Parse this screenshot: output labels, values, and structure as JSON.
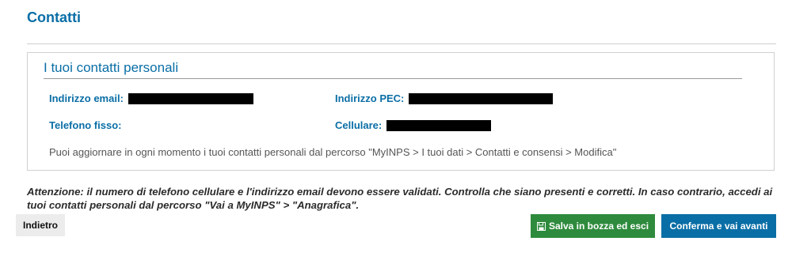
{
  "page": {
    "title": "Contatti"
  },
  "panel": {
    "title": "I tuoi contatti personali",
    "email_label": "Indirizzo email:",
    "pec_label": "Indirizzo PEC:",
    "phone_label": "Telefono fisso:",
    "phone_value": "",
    "mobile_label": "Cellulare:",
    "note": "Puoi aggiornare in ogni momento i tuoi contatti personali dal percorso \"MyINPS > I tuoi dati > Contatti e consensi > Modifica\""
  },
  "warning": "Attenzione: il numero di telefono cellulare e l'indirizzo email devono essere validati. Controlla che siano presenti e corretti. In caso contrario, accedi ai tuoi contatti personali dal percorso \"Vai a MyINPS\" > \"Anagrafica\".",
  "buttons": {
    "back_label": "Indietro",
    "save_label": "Salva in bozza ed esci",
    "save_icon": "floppy-disk-icon",
    "next_label": "Conferma e vai avanti"
  },
  "colors": {
    "accent": "#0a6ea6",
    "save": "#2e8b3d",
    "redaction": "#000000"
  }
}
